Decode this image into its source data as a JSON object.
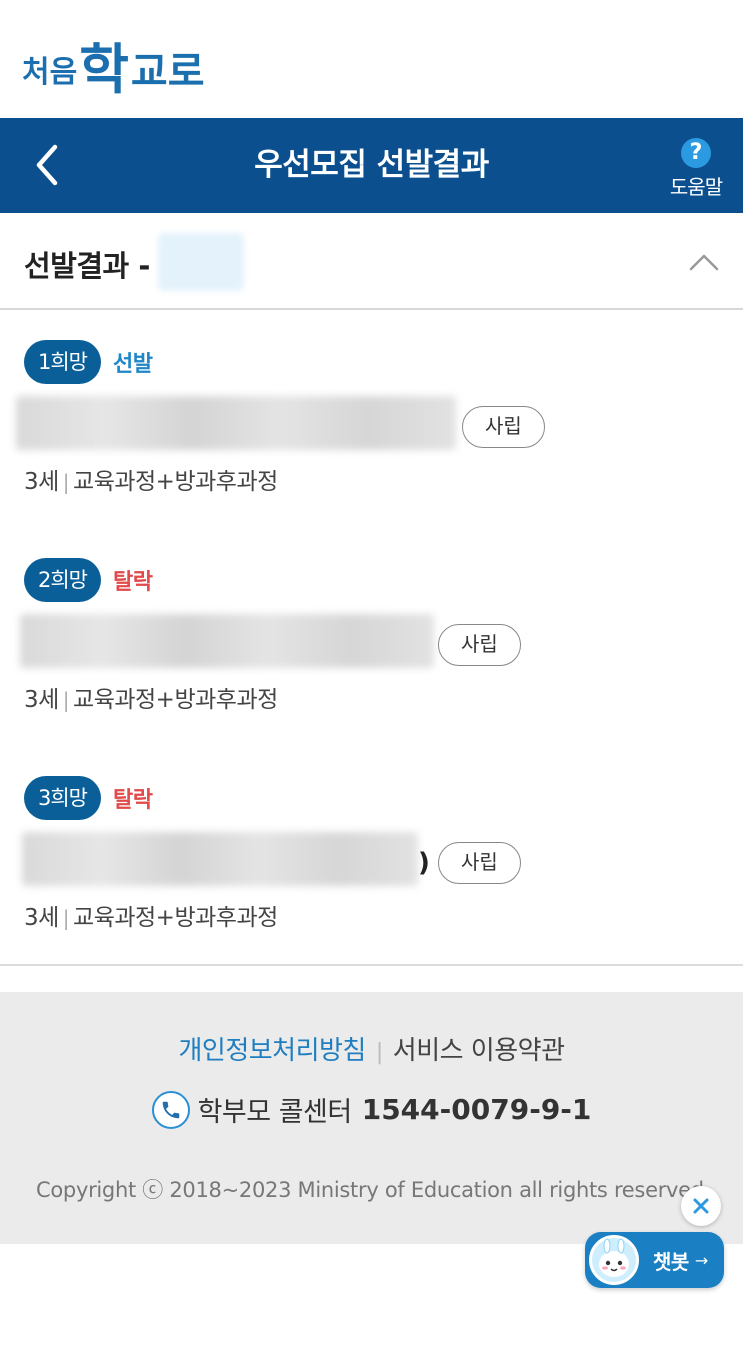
{
  "logo": {
    "part1": "처음",
    "part2": "학",
    "part3": "교로"
  },
  "header": {
    "title": "우선모집 선발결과",
    "help_label": "도움말",
    "help_glyph": "?"
  },
  "section": {
    "title": "선발결과 -"
  },
  "choices": [
    {
      "rank": "1희망",
      "status": "선발",
      "type": "사립",
      "meta_age": "3세",
      "meta_course": "교육과정+방과후과정"
    },
    {
      "rank": "2희망",
      "status": "탈락",
      "type": "사립",
      "meta_age": "3세",
      "meta_course": "교육과정+방과후과정"
    },
    {
      "rank": "3희망",
      "status": "탈락",
      "type": "사립",
      "meta_age": "3세",
      "meta_course": "교육과정+방과후과정",
      "paren": ")"
    }
  ],
  "footer": {
    "privacy": "개인정보처리방침",
    "terms": "서비스 이용약관",
    "callcenter_label": "학부모 콜센터",
    "callcenter_number": "1544-0079-9-1",
    "copyright": "Copyright ⓒ 2018~2023 Ministry of Education all rights reserved"
  },
  "chatbot": {
    "label": "챗봇",
    "arrow": "→"
  },
  "colors": {
    "header_bg": "#0b4f8f",
    "badge": "#0b5f99",
    "pass": "#1f86c8",
    "fail": "#e04a4a",
    "footer_bg": "#ebebeb"
  }
}
